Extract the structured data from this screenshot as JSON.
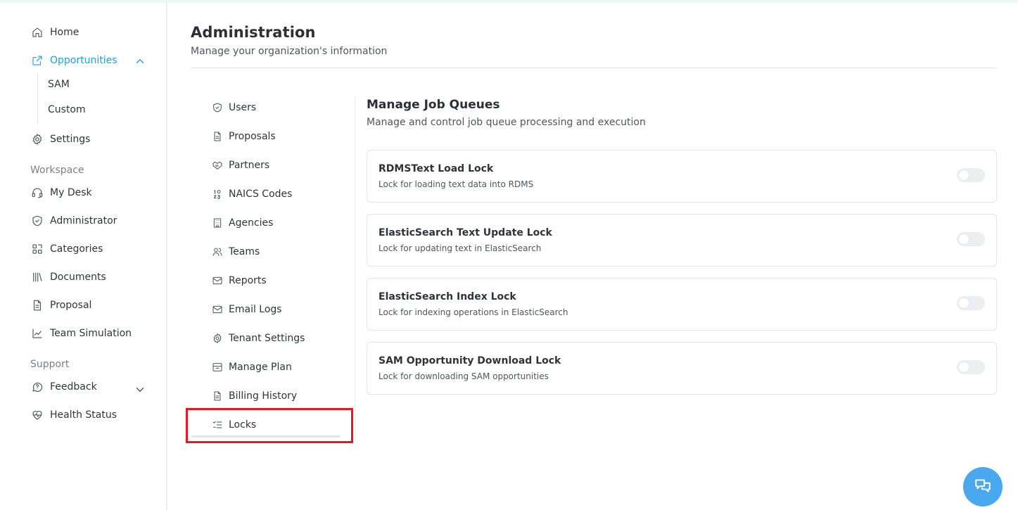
{
  "colors": {
    "accent": "#1aa0dc",
    "highlight": "#e01b24",
    "chat": "#4aa8ee"
  },
  "sidebar": {
    "home": "Home",
    "opportunities": "Opportunities",
    "opportunities_sub": [
      "SAM",
      "Custom"
    ],
    "settings": "Settings",
    "workspace_label": "Workspace",
    "workspace_items": [
      "My Desk",
      "Administrator",
      "Categories",
      "Documents",
      "Proposal",
      "Team Simulation"
    ],
    "support_label": "Support",
    "feedback": "Feedback",
    "health_status": "Health Status"
  },
  "header": {
    "title": "Administration",
    "subtitle": "Manage your organization's information"
  },
  "admin_menu": {
    "items": [
      "Users",
      "Proposals",
      "Partners",
      "NAICS Codes",
      "Agencies",
      "Teams",
      "Reports",
      "Email Logs",
      "Tenant Settings",
      "Manage Plan",
      "Billing History",
      "Locks"
    ],
    "selected": "Locks"
  },
  "content": {
    "title": "Manage Job Queues",
    "subtitle": "Manage and control job queue processing and execution",
    "locks": [
      {
        "title": "RDMSText Load Lock",
        "description": "Lock for loading text data into RDMS",
        "enabled": false
      },
      {
        "title": "ElasticSearch Text Update Lock",
        "description": "Lock for updating text in ElasticSearch",
        "enabled": false
      },
      {
        "title": "ElasticSearch Index Lock",
        "description": "Lock for indexing operations in ElasticSearch",
        "enabled": false
      },
      {
        "title": "SAM Opportunity Download Lock",
        "description": "Lock for downloading SAM opportunities",
        "enabled": false
      }
    ]
  },
  "icons": {
    "sidebar": [
      "home-icon",
      "external-link-icon",
      "gear-icon",
      "headset-icon",
      "shield-icon",
      "categories-icon",
      "library-icon",
      "file-icon",
      "chart-line-icon",
      "message-question-icon",
      "heart-pulse-icon"
    ],
    "admin": [
      "shield-check-icon",
      "file-text-icon",
      "handshake-icon",
      "number-icon",
      "building-icon",
      "users-icon",
      "mail-icon",
      "mail-icon",
      "gear-icon",
      "archive-icon",
      "file-text-icon",
      "list-check-icon"
    ],
    "chat": "chat-icon"
  }
}
